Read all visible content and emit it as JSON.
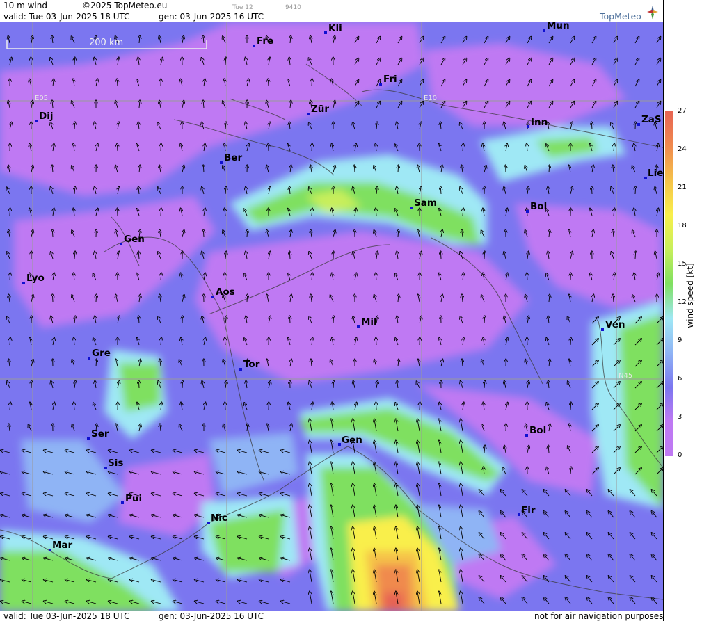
{
  "header": {
    "title": "10 m wind",
    "copyright": "©2025 TopMeteo.eu",
    "run_label": "Tue 12",
    "run_code": "9410",
    "valid_line": "valid:  Tue  03-Jun-2025  18 UTC",
    "gen_line": "gen: 03-Jun-2025 16 UTC",
    "logo_text": "TopMeteo"
  },
  "footer": {
    "valid_line": "valid:  Tue  03-Jun-2025  18 UTC",
    "gen_line": "gen: 03-Jun-2025 16 UTC",
    "disclaimer": "not for air navigation purposes"
  },
  "scale_bar": {
    "label": "200 km"
  },
  "grid_labels": {
    "lon_1": "E05",
    "lon_2": "E10",
    "lat_1": "N45"
  },
  "legend": {
    "unit_label": "wind speed [kt]",
    "ticks": [
      "27",
      "24",
      "21",
      "18",
      "15",
      "12",
      "9",
      "6",
      "3",
      "0"
    ],
    "colors": [
      "#e76453",
      "#f08a4e",
      "#f5c24a",
      "#f9ef4b",
      "#c8ef5b",
      "#7fe060",
      "#9fe8f5",
      "#8fb4f5",
      "#7b76f0",
      "#bf79f3"
    ]
  },
  "cities": [
    {
      "id": "kli",
      "label": "Kli"
    },
    {
      "id": "mun",
      "label": "Mun"
    },
    {
      "id": "fre",
      "label": "Fre"
    },
    {
      "id": "fri",
      "label": "Fri"
    },
    {
      "id": "dij",
      "label": "Dij"
    },
    {
      "id": "zur",
      "label": "Zür"
    },
    {
      "id": "inn",
      "label": "Inn"
    },
    {
      "id": "zas",
      "label": "ZaS"
    },
    {
      "id": "ber",
      "label": "Ber"
    },
    {
      "id": "lie",
      "label": "Lie"
    },
    {
      "id": "sam",
      "label": "Sam"
    },
    {
      "id": "bol1",
      "label": "Bol"
    },
    {
      "id": "gen1",
      "label": "Gen"
    },
    {
      "id": "lyo",
      "label": "Lyo"
    },
    {
      "id": "aos",
      "label": "Aos"
    },
    {
      "id": "mil",
      "label": "Mil"
    },
    {
      "id": "ven",
      "label": "Ven"
    },
    {
      "id": "gre",
      "label": "Gre"
    },
    {
      "id": "tor",
      "label": "Tor"
    },
    {
      "id": "ser",
      "label": "Ser"
    },
    {
      "id": "gen2",
      "label": "Gen"
    },
    {
      "id": "bol2",
      "label": "Bol"
    },
    {
      "id": "sis",
      "label": "Sis"
    },
    {
      "id": "pui",
      "label": "Pui"
    },
    {
      "id": "fir",
      "label": "Fir"
    },
    {
      "id": "nic",
      "label": "Nic"
    },
    {
      "id": "mar",
      "label": "Mar"
    }
  ]
}
